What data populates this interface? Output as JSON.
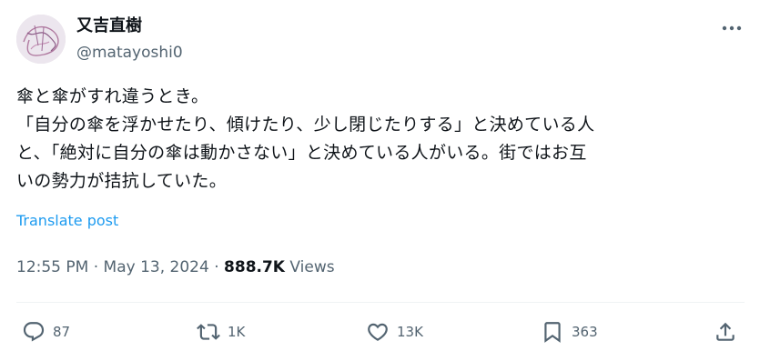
{
  "author": {
    "display_name": "又吉直樹",
    "handle": "@matayoshi0"
  },
  "tweet": {
    "lines": [
      "傘と傘がすれ違うとき。",
      "「自分の傘を浮かせたり、傾けたり、少し閉じたりする」と決めている人",
      "と、「絶対に自分の傘は動かさない」と決めている人がいる。街ではお互",
      "いの勢力が拮抗していた。"
    ],
    "translate_label": "Translate post"
  },
  "meta": {
    "time": "12:55 PM",
    "separator": "·",
    "date": "May 13, 2024",
    "views_count": "888.7K",
    "views_label": "Views"
  },
  "actions": {
    "replies": "87",
    "reposts": "1K",
    "likes": "13K",
    "bookmarks": "363"
  },
  "icons": [
    "more-icon",
    "reply-icon",
    "repost-icon",
    "like-icon",
    "bookmark-icon",
    "share-icon"
  ],
  "colors": {
    "text": "#0f1419",
    "secondary": "#536471",
    "link": "#1d9bf0",
    "divider": "#eff3f4"
  }
}
